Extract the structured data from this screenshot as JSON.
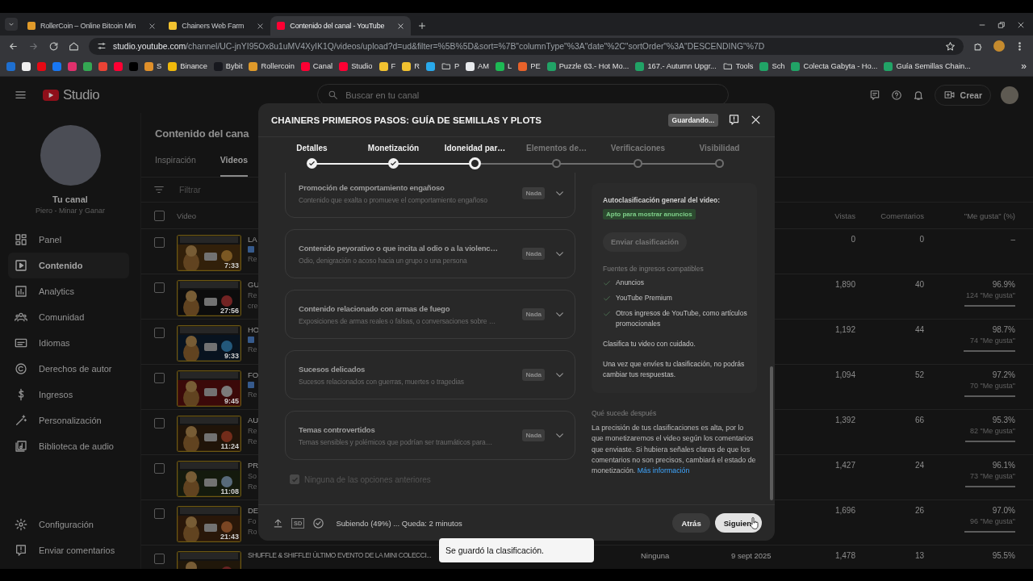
{
  "browser": {
    "tabs": [
      {
        "title": "RollerCoin – Online Bitcoin Min",
        "selected": false,
        "color": "#e09a2a"
      },
      {
        "title": "Chainers Web Farm",
        "selected": false,
        "color": "#f2c230"
      },
      {
        "title": "Contenido del canal - YouTube",
        "selected": true,
        "color": "#ff0033"
      }
    ],
    "url_host": "studio.youtube.com",
    "url_path": "/channel/UC-jnYI95Ox8u1uMV4XyIK1Q/videos/upload?d=ud&filter=%5B%5D&sort=%7B\"columnType\"%3A\"date\"%2C\"sortOrder\"%3A\"DESCENDING\"%7D",
    "bookmarks": [
      {
        "kind": "site",
        "color": "#1e6fd0"
      },
      {
        "kind": "site",
        "color": "#f0f0f0"
      },
      {
        "kind": "site",
        "color": "#e50914"
      },
      {
        "kind": "site",
        "color": "#1877f2"
      },
      {
        "kind": "site",
        "color": "#e1306c"
      },
      {
        "kind": "site",
        "color": "#34a853"
      },
      {
        "kind": "site",
        "color": "#ea4335"
      },
      {
        "kind": "site",
        "color": "#ff0033"
      },
      {
        "kind": "site",
        "color": "#000000"
      },
      {
        "kind": "site",
        "label": "S",
        "color": "#e0902a"
      },
      {
        "kind": "site",
        "label": "Binance",
        "color": "#f0b90b"
      },
      {
        "kind": "site",
        "label": "Bybit",
        "color": "#17181e"
      },
      {
        "kind": "site",
        "label": "Rollercoin",
        "color": "#e09a2a"
      },
      {
        "kind": "site",
        "label": "Canal",
        "color": "#ff0033"
      },
      {
        "kind": "site",
        "label": "Studio",
        "color": "#ff0033"
      },
      {
        "kind": "site",
        "label": "F",
        "color": "#f2c230"
      },
      {
        "kind": "site",
        "label": "R",
        "color": "#f2c230"
      },
      {
        "kind": "site",
        "color": "#29a9eb"
      },
      {
        "kind": "folder",
        "label": "P"
      },
      {
        "kind": "site",
        "label": "AM",
        "color": "#e8eaed"
      },
      {
        "kind": "site",
        "label": "L",
        "color": "#1db954"
      },
      {
        "kind": "site",
        "label": "PE",
        "color": "#e8622a"
      },
      {
        "kind": "site",
        "label": "Puzzle 63.- Hot Mo...",
        "color": "#21a366"
      },
      {
        "kind": "site",
        "label": "167.- Autumn Upgr...",
        "color": "#21a366"
      },
      {
        "kind": "folder",
        "label": "Tools"
      },
      {
        "kind": "site",
        "label": "Sch",
        "color": "#21a366"
      },
      {
        "kind": "site",
        "label": "Colecta Gabyta - Ho...",
        "color": "#21a366"
      },
      {
        "kind": "site",
        "label": "Guía Semillas Chain...",
        "color": "#21a366"
      }
    ],
    "more": "»"
  },
  "studio": {
    "logo": "Studio",
    "search": {
      "placeholder": "Buscar en tu canal"
    },
    "create_button": "Crear",
    "channel": {
      "name": "Tu canal",
      "handle": "Piero - Minar y Ganar"
    },
    "nav": [
      {
        "label": "Panel",
        "selected": false
      },
      {
        "label": "Contenido",
        "selected": true
      },
      {
        "label": "Analytics",
        "selected": false
      },
      {
        "label": "Comunidad",
        "selected": false
      },
      {
        "label": "Idiomas",
        "selected": false
      },
      {
        "label": "Derechos de autor",
        "selected": false
      },
      {
        "label": "Ingresos",
        "selected": false
      },
      {
        "label": "Personalización",
        "selected": false
      },
      {
        "label": "Biblioteca de audio",
        "selected": false
      }
    ],
    "nav_bottom": [
      "Configuración",
      "Enviar comentarios"
    ],
    "page_title": "Contenido del cana",
    "tabs": [
      {
        "label": "Inspiración",
        "selected": false
      },
      {
        "label": "Videos",
        "selected": true
      }
    ],
    "filter": {
      "placeholder": "Filtrar"
    },
    "table": {
      "columns": [
        "Video",
        "Vistas",
        "Comentarios",
        "\"Me gusta\" (%)"
      ],
      "all_selected": false,
      "rows": [
        {
          "selected": false,
          "duration": "7:33",
          "title": "LA",
          "lines": [
            {
              "kind": "icon"
            },
            {
              "kind": "text",
              "text": "Re"
            }
          ],
          "views": "0",
          "comments": "0",
          "likes_pct": "–"
        },
        {
          "selected": false,
          "duration": "27:56",
          "title": "GU",
          "lines": [
            {
              "kind": "text",
              "text": "Re"
            },
            {
              "kind": "text",
              "text": "cre"
            }
          ],
          "views": "1,890",
          "comments": "40",
          "likes_pct": "96.9%",
          "likes_count": "124 \"Me gusta\"",
          "level": 0.969
        },
        {
          "selected": false,
          "duration": "9:33",
          "title": "HO",
          "lines": [
            {
              "kind": "icon"
            },
            {
              "kind": "text",
              "text": "Re"
            }
          ],
          "views": "1,192",
          "comments": "44",
          "likes_pct": "98.7%",
          "likes_count": "74 \"Me gusta\"",
          "level": 0.987
        },
        {
          "selected": false,
          "duration": "9:45",
          "title": "FO",
          "lines": [
            {
              "kind": "icon"
            },
            {
              "kind": "text",
              "text": "Re"
            }
          ],
          "views": "1,094",
          "comments": "52",
          "likes_pct": "97.2%",
          "likes_count": "70 \"Me gusta\"",
          "level": 0.972
        },
        {
          "selected": false,
          "duration": "11:24",
          "title": "AU",
          "lines": [
            {
              "kind": "text",
              "text": "Re"
            },
            {
              "kind": "text",
              "text": "Re"
            }
          ],
          "views": "1,392",
          "comments": "66",
          "likes_pct": "95.3%",
          "likes_count": "82 \"Me gusta\"",
          "level": 0.953
        },
        {
          "selected": false,
          "duration": "11:08",
          "title": "PR",
          "lines": [
            {
              "kind": "text",
              "text": "So"
            },
            {
              "kind": "text",
              "text": "Re"
            }
          ],
          "views": "1,427",
          "comments": "24",
          "likes_pct": "96.1%",
          "likes_count": "73 \"Me gusta\"",
          "level": 0.961
        },
        {
          "selected": false,
          "duration": "21:43",
          "title": "DE",
          "lines": [
            {
              "kind": "text",
              "text": "Fo"
            },
            {
              "kind": "text",
              "text": "Ro"
            }
          ],
          "views": "1,696",
          "comments": "26",
          "likes_pct": "97.0%",
          "likes_count": "96 \"Me gusta\"",
          "level": 0.97
        },
        {
          "selected": false,
          "title": "SHUFFLE & SHIFFLE! ÚLTIMO EVENTO DE LA MINI COLECCI...",
          "restriction": "Ninguna",
          "date": "9 sept 2025",
          "views": "1,478",
          "comments": "13",
          "likes_pct": "95.5%"
        }
      ]
    }
  },
  "modal": {
    "title": "CHAINERS PRIMEROS PASOS: GUÍA DE SEMILLAS Y PLOTS",
    "status": "Guardando...",
    "steps": [
      {
        "label": "Detalles",
        "done": true,
        "selected": false
      },
      {
        "label": "Monetización",
        "done": true,
        "selected": false
      },
      {
        "label": "Idoneidad par…",
        "done": false,
        "selected": true
      },
      {
        "label": "Elementos de…",
        "done": false,
        "selected": false
      },
      {
        "label": "Verificaciones",
        "done": false,
        "selected": false
      },
      {
        "label": "Visibilidad",
        "done": false,
        "selected": false
      }
    ],
    "categories": [
      {
        "title": "Promoción de comportamiento engañoso",
        "description": "Contenido que exalta o promueve el comportamiento engañoso",
        "rating": "Nada"
      },
      {
        "title": "Contenido peyorativo o que incita al odio o a la violenc…",
        "description": "Odio, denigración o acoso hacia un grupo o una persona",
        "rating": "Nada"
      },
      {
        "title": "Contenido relacionado con armas de fuego",
        "description": "Exposiciones de armas reales o falsas, o conversaciones sobre …",
        "rating": "Nada"
      },
      {
        "title": "Sucesos delicados",
        "description": "Sucesos relacionados con guerras, muertes o tragedias",
        "rating": "Nada"
      },
      {
        "title": "Temas controvertidos",
        "description": "Temas sensibles y polémicos que podrían ser traumáticos para…",
        "rating": "Nada"
      }
    ],
    "none_option": {
      "label": "Ninguna de las opciones anteriores",
      "checked": true,
      "disabled": true
    },
    "summary": {
      "heading": "Autoclasificación general del video:",
      "badge": "Apto para mostrar anuncios",
      "submit_button": "Enviar clasificación",
      "revenue_heading": "Fuentes de ingresos compatibles",
      "revenue_sources": [
        "Anuncios",
        "YouTube Premium",
        "Otros ingresos de YouTube, como artículos promocionales"
      ],
      "notes": [
        "Clasifica tu video con cuidado.",
        "Una vez que envíes tu clasificación, no podrás cambiar tus respuestas."
      ]
    },
    "next_heading": "Qué sucede después",
    "next_text": "La precisión de tus clasificaciones es alta, por lo que monetizaremos el video según los comentarios que enviaste. Si hubiera señales claras de que los comentarios no son precisos, cambiará el estado de monetización.",
    "next_link": "Más información",
    "quality": "SD",
    "upload_status": "Subiendo (49%) ... Queda: 2 minutos",
    "back_button": "Atrás",
    "next_button": "Siguien"
  },
  "toast": "Se guardó la clasificación."
}
